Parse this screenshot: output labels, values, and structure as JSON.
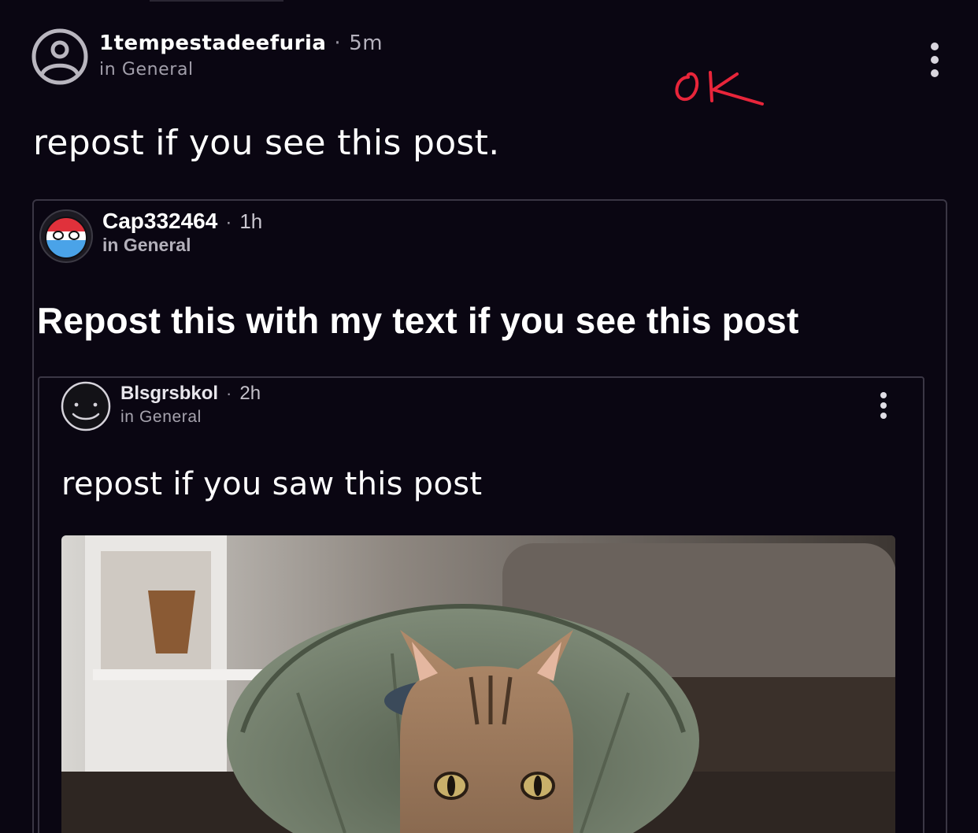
{
  "outer_post": {
    "author": "1tempestadeefuria",
    "separator": "·",
    "time": "5m",
    "community": "in General",
    "text": "repost if you see this post.",
    "annotation": "ok"
  },
  "quoted_post_1": {
    "author": "Cap332464",
    "separator": "·",
    "time": "1h",
    "community": "in General",
    "text": "Repost this with my text if you see this post"
  },
  "quoted_post_2": {
    "author": "Blsgrsbkol",
    "separator": "·",
    "time": "2h",
    "community": "in General",
    "text": "repost if you saw this post"
  },
  "colors": {
    "background": "#0a0612",
    "annotation_red": "#e8253a",
    "card_border": "#3a3644",
    "flag_red": "#e0313b",
    "flag_blue": "#4aa3e8"
  },
  "icons": {
    "outer_avatar": "user-outline-icon",
    "outer_menu": "more-vertical-icon",
    "quoted_1_avatar": "flag-ball-avatar",
    "quoted_2_avatar": "dark-face-avatar",
    "quoted_2_menu": "more-vertical-icon"
  }
}
